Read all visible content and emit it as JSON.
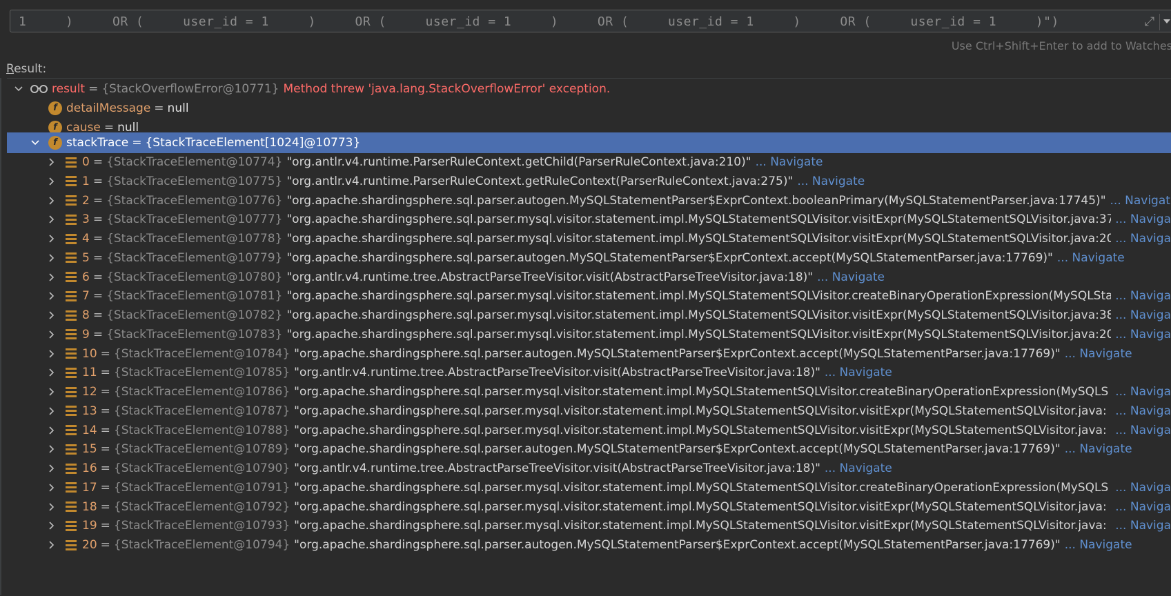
{
  "expression": {
    "text": "1     )     OR (     user_id = 1     )     OR (     user_id = 1     )     OR (     user_id = 1     )     OR (     user_id = 1     )\")"
  },
  "hint": "Use Ctrl+Shift+Enter to add to Watches",
  "result_label": {
    "first": "R",
    "rest": "esult:"
  },
  "tree": {
    "result": {
      "name": "result",
      "eq": "=",
      "type": "{StackOverflowError@10771}",
      "message": "Method threw 'java.lang.StackOverflowError' exception."
    },
    "detailMessage": {
      "name": "detailMessage",
      "eq": "=",
      "value": "null"
    },
    "cause": {
      "name": "cause",
      "eq": "=",
      "value": "null"
    },
    "stackTrace": {
      "name": "stackTrace",
      "eq": "=",
      "type": "{StackTraceElement[1024]@10773}"
    },
    "frames": [
      {
        "idx": "0",
        "type": "{StackTraceElement@10774}",
        "val": "\"org.antlr.v4.runtime.ParserRuleContext.getChild(ParserRuleContext.java:210)\"",
        "nav": "... Navigate",
        "nav_clip": false
      },
      {
        "idx": "1",
        "type": "{StackTraceElement@10775}",
        "val": "\"org.antlr.v4.runtime.ParserRuleContext.getRuleContext(ParserRuleContext.java:275)\"",
        "nav": "... Navigate",
        "nav_clip": false
      },
      {
        "idx": "2",
        "type": "{StackTraceElement@10776}",
        "val": "\"org.apache.shardingsphere.sql.parser.autogen.MySQLStatementParser$ExprContext.booleanPrimary(MySQLStatementParser.java:17745)\"",
        "nav": "... Navigat",
        "nav_clip": false
      },
      {
        "idx": "3",
        "type": "{StackTraceElement@10777}",
        "val": "\"org.apache.shardingsphere.sql.parser.mysql.visitor.statement.impl.MySQLStatementSQLVisitor.visitExpr(MySQLStatementSQLVisitor.java:37",
        "nav": "... Naviga",
        "nav_clip": true
      },
      {
        "idx": "4",
        "type": "{StackTraceElement@10778}",
        "val": "\"org.apache.shardingsphere.sql.parser.mysql.visitor.statement.impl.MySQLStatementSQLVisitor.visitExpr(MySQLStatementSQLVisitor.java:20",
        "nav": "... Naviga",
        "nav_clip": true
      },
      {
        "idx": "5",
        "type": "{StackTraceElement@10779}",
        "val": "\"org.apache.shardingsphere.sql.parser.autogen.MySQLStatementParser$ExprContext.accept(MySQLStatementParser.java:17769)\"",
        "nav": "... Navigate",
        "nav_clip": false
      },
      {
        "idx": "6",
        "type": "{StackTraceElement@10780}",
        "val": "\"org.antlr.v4.runtime.tree.AbstractParseTreeVisitor.visit(AbstractParseTreeVisitor.java:18)\"",
        "nav": "... Navigate",
        "nav_clip": false
      },
      {
        "idx": "7",
        "type": "{StackTraceElement@10781}",
        "val": "\"org.apache.shardingsphere.sql.parser.mysql.visitor.statement.impl.MySQLStatementSQLVisitor.createBinaryOperationExpression(MySQLSta",
        "nav": "... Naviga",
        "nav_clip": true
      },
      {
        "idx": "8",
        "type": "{StackTraceElement@10782}",
        "val": "\"org.apache.shardingsphere.sql.parser.mysql.visitor.statement.impl.MySQLStatementSQLVisitor.visitExpr(MySQLStatementSQLVisitor.java:38",
        "nav": "... Naviga",
        "nav_clip": true
      },
      {
        "idx": "9",
        "type": "{StackTraceElement@10783}",
        "val": "\"org.apache.shardingsphere.sql.parser.mysql.visitor.statement.impl.MySQLStatementSQLVisitor.visitExpr(MySQLStatementSQLVisitor.java:20",
        "nav": "... Naviga",
        "nav_clip": true
      },
      {
        "idx": "10",
        "type": "{StackTraceElement@10784}",
        "val": "\"org.apache.shardingsphere.sql.parser.autogen.MySQLStatementParser$ExprContext.accept(MySQLStatementParser.java:17769)\"",
        "nav": "... Navigate",
        "nav_clip": false
      },
      {
        "idx": "11",
        "type": "{StackTraceElement@10785}",
        "val": "\"org.antlr.v4.runtime.tree.AbstractParseTreeVisitor.visit(AbstractParseTreeVisitor.java:18)\"",
        "nav": "... Navigate",
        "nav_clip": false
      },
      {
        "idx": "12",
        "type": "{StackTraceElement@10786}",
        "val": "\"org.apache.shardingsphere.sql.parser.mysql.visitor.statement.impl.MySQLStatementSQLVisitor.createBinaryOperationExpression(MySQLS",
        "nav": "... Naviga",
        "nav_clip": true
      },
      {
        "idx": "13",
        "type": "{StackTraceElement@10787}",
        "val": "\"org.apache.shardingsphere.sql.parser.mysql.visitor.statement.impl.MySQLStatementSQLVisitor.visitExpr(MySQLStatementSQLVisitor.java:",
        "nav": "... Naviga",
        "nav_clip": true
      },
      {
        "idx": "14",
        "type": "{StackTraceElement@10788}",
        "val": "\"org.apache.shardingsphere.sql.parser.mysql.visitor.statement.impl.MySQLStatementSQLVisitor.visitExpr(MySQLStatementSQLVisitor.java:",
        "nav": "... Naviga",
        "nav_clip": true
      },
      {
        "idx": "15",
        "type": "{StackTraceElement@10789}",
        "val": "\"org.apache.shardingsphere.sql.parser.autogen.MySQLStatementParser$ExprContext.accept(MySQLStatementParser.java:17769)\"",
        "nav": "... Navigate",
        "nav_clip": false
      },
      {
        "idx": "16",
        "type": "{StackTraceElement@10790}",
        "val": "\"org.antlr.v4.runtime.tree.AbstractParseTreeVisitor.visit(AbstractParseTreeVisitor.java:18)\"",
        "nav": "... Navigate",
        "nav_clip": false
      },
      {
        "idx": "17",
        "type": "{StackTraceElement@10791}",
        "val": "\"org.apache.shardingsphere.sql.parser.mysql.visitor.statement.impl.MySQLStatementSQLVisitor.createBinaryOperationExpression(MySQLS",
        "nav": "... Naviga",
        "nav_clip": true
      },
      {
        "idx": "18",
        "type": "{StackTraceElement@10792}",
        "val": "\"org.apache.shardingsphere.sql.parser.mysql.visitor.statement.impl.MySQLStatementSQLVisitor.visitExpr(MySQLStatementSQLVisitor.java:",
        "nav": "... Naviga",
        "nav_clip": true
      },
      {
        "idx": "19",
        "type": "{StackTraceElement@10793}",
        "val": "\"org.apache.shardingsphere.sql.parser.mysql.visitor.statement.impl.MySQLStatementSQLVisitor.visitExpr(MySQLStatementSQLVisitor.java:",
        "nav": "... Naviga",
        "nav_clip": true
      },
      {
        "idx": "20",
        "type": "{StackTraceElement@10794}",
        "val": "\"org.apache.shardingsphere.sql.parser.autogen.MySQLStatementParser$ExprContext.accept(MySQLStatementParser.java:17769)\"",
        "nav": "... Navigate",
        "nav_clip": false
      }
    ]
  },
  "colors": {
    "background": "#2b2b2b",
    "selection": "#4b6eaf",
    "error": "#ff6b68",
    "field_name": "#e1a06b",
    "link": "#5f8fcf",
    "field_icon": "#c2892e"
  }
}
